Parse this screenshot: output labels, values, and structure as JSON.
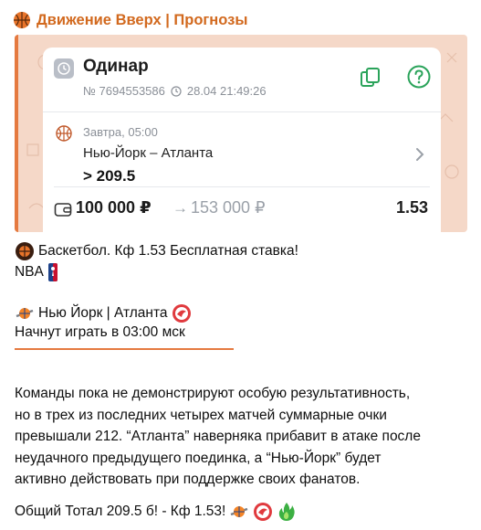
{
  "channel": {
    "name": "Движение Вверх | Прогнозы",
    "icon": "basketball-icon"
  },
  "preview": {
    "title": "Одинар",
    "bet_id": "№ 7694553586",
    "datetime": "28.04 21:49:26",
    "event_time": "Завтра, 05:00",
    "teams": "Нью-Йорк – Атланта",
    "selection": "> 209.5",
    "stake": "100 000 ₽",
    "arrow": "→",
    "payout": "153 000 ₽",
    "odds": "1.53",
    "colors": {
      "accent": "#e57a40",
      "frame_bg": "#f5d8c8",
      "channel": "#d2691e"
    }
  },
  "message": {
    "line1": "Баскетбол. Кф 1.53 Бесплатная ставка!",
    "line2": "NBA",
    "line3": "Нью Йорк | Атланта",
    "line4": "Начнут играть в 03:00 мск",
    "paragraph": [
      "Команды пока не демонстрируют особую результативность,",
      "но в трех из последних четырех матчей суммарные очки",
      "превышали 212. “Атланта” наверняка прибавит в атаке после",
      "неудачного предыдущего поединка, а “Нью-Йорк” будет",
      "активно действовать при поддержке своих фанатов."
    ],
    "footer": "Общий Тотал 209.5 б! - Кф 1.53!"
  }
}
